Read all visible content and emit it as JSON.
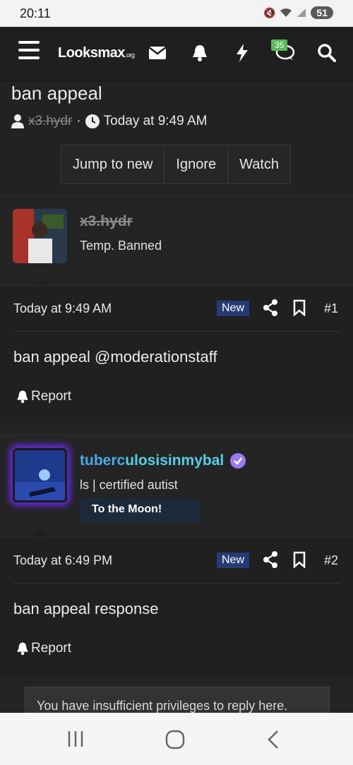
{
  "status_bar": {
    "time": "20:11",
    "battery": "51"
  },
  "nav": {
    "logo_main": "Lᴏoksmax",
    "logo_suffix": ".org",
    "chat_badge": "35"
  },
  "thread": {
    "title": "ban appeal",
    "author": "x3.hydr",
    "separator": "·",
    "time": "Today at 9:49 AM",
    "buttons": [
      "Jump to new",
      "Ignore",
      "Watch"
    ]
  },
  "posts": [
    {
      "user": {
        "name": "x3.hydr",
        "title": "Temp. Banned"
      },
      "date": "Today at 9:49 AM",
      "new_label": "New",
      "number": "#1",
      "body": "ban appeal @moderationstaff",
      "report": "Report"
    },
    {
      "user": {
        "name_part1": "tuberc",
        "name_part2": "ulosisinmybal",
        "title": "ls | certified autist",
        "banner": "To the Moon!"
      },
      "date": "Today at 6:49 PM",
      "new_label": "New",
      "number": "#2",
      "body": "ban appeal response",
      "report": "Report"
    }
  ],
  "notice": "You have insufficient privileges to reply here.",
  "colors": {
    "new_badge": "#243b74",
    "chat_badge": "#5cb85c",
    "name_blue": "#4aa8e8",
    "name_cyan": "#52d0e8",
    "verified": "#9b7bf0",
    "avatar_glow": "#6a2cf0"
  }
}
